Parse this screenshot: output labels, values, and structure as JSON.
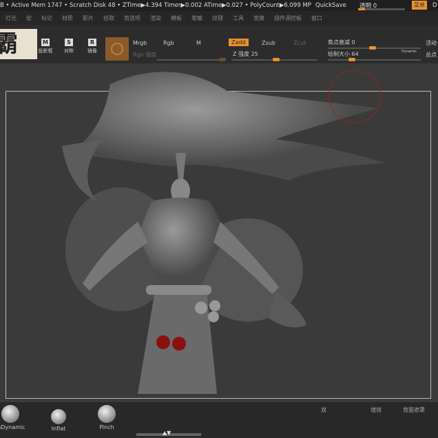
{
  "status": {
    "text": "B • Active Mem 1747 • Scratch Disk 48 • ZTime▶4.394 Timer▶0.002 ATime▶0.027 • PolyCount▶6.099 MP",
    "quicksave": "QuickSave",
    "transparency_label": "透明 0",
    "transparency_value": 0,
    "menu_button": "菜单",
    "cut_label": "D"
  },
  "menu": [
    "灯光",
    "宏",
    "标记",
    "材质",
    "影片",
    "拾取",
    "首选项",
    "渲染",
    "模板",
    "笔触",
    "纹理",
    "工具",
    "变换",
    "插件调控板",
    "窗口"
  ],
  "toolbar": {
    "logo": "霸",
    "buttons": [
      {
        "glyph": "M",
        "label": "投影框"
      },
      {
        "glyph": "S",
        "label": "对称"
      },
      {
        "glyph": "R",
        "label": "镜像"
      }
    ],
    "mrgb": "Mrgb",
    "rgb": "Rgb",
    "m": "M",
    "rgb_intensity": "Rgb 强度",
    "zadd": "Zadd",
    "zsub": "Zsub",
    "zcut": "Zcut",
    "z_intensity": "Z 强度 25",
    "focal_shift": "焦点衰减 0",
    "draw_size": "绘制大小 64",
    "dynamic": "Dynamic",
    "active_points": "活动",
    "total_points": "总点",
    "accent": "#e8922e"
  },
  "brushes": [
    {
      "label": "mDynamic"
    },
    {
      "label": "Inflat"
    },
    {
      "label": "Pinch"
    }
  ],
  "right_buttons": [
    "双",
    "增效",
    "背面遮罩"
  ]
}
